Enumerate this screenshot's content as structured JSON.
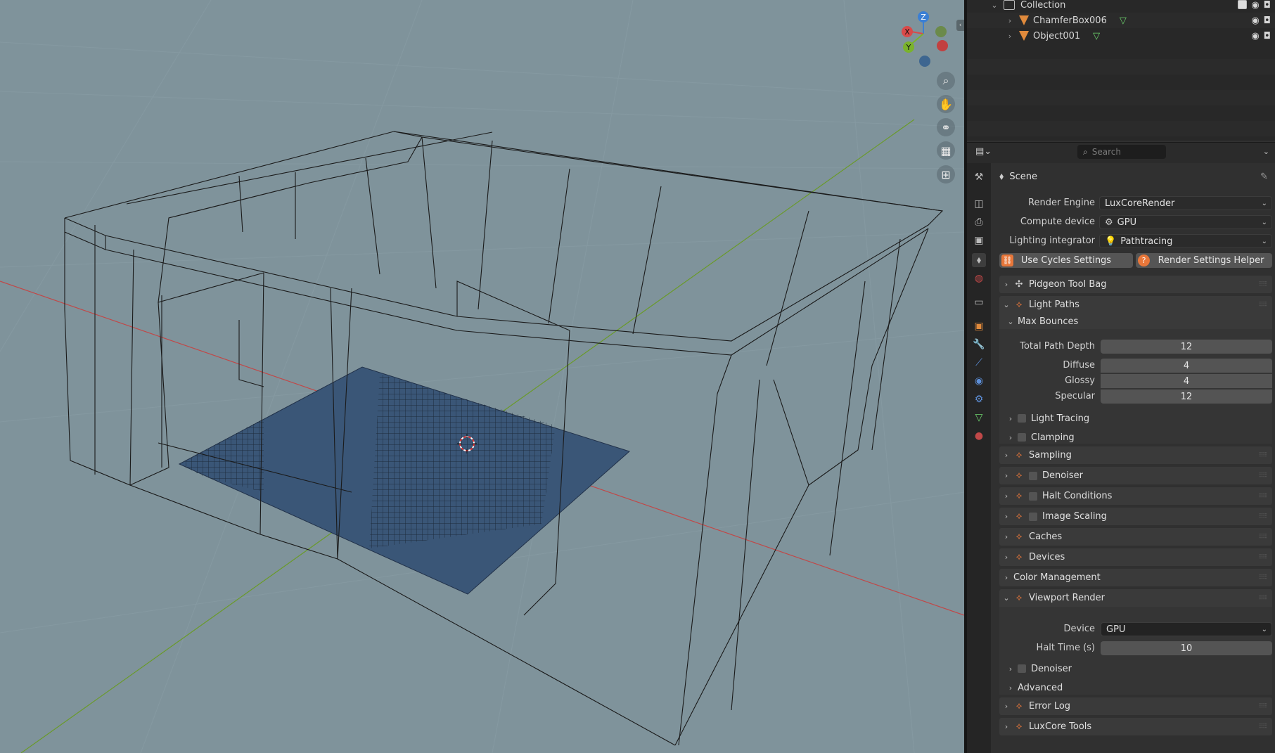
{
  "outliner": {
    "collection_label": "Collection",
    "objects": [
      {
        "name": "ChamferBox006"
      },
      {
        "name": "Object001"
      }
    ]
  },
  "properties": {
    "search_placeholder": "Search",
    "context_title": "Scene",
    "render_engine": {
      "label": "Render Engine",
      "value": "LuxCoreRender"
    },
    "compute_device": {
      "label": "Compute device",
      "value": "GPU"
    },
    "lighting_integrator": {
      "label": "Lighting integrator",
      "value": "Pathtracing"
    },
    "use_cycles_button": "Use Cycles Settings",
    "render_helper_button": "Render Settings Helper",
    "panels": {
      "pidgeon": "Pidgeon Tool Bag",
      "light_paths": "Light Paths",
      "max_bounces": "Max Bounces",
      "total_path_depth": {
        "label": "Total Path Depth",
        "value": "12"
      },
      "diffuse": {
        "label": "Diffuse",
        "value": "4"
      },
      "glossy": {
        "label": "Glossy",
        "value": "4"
      },
      "specular": {
        "label": "Specular",
        "value": "12"
      },
      "light_tracing": "Light Tracing",
      "clamping": "Clamping",
      "sampling": "Sampling",
      "denoiser": "Denoiser",
      "halt_conditions": "Halt Conditions",
      "image_scaling": "Image Scaling",
      "caches": "Caches",
      "devices": "Devices",
      "color_management": "Color Management",
      "viewport_render": "Viewport Render",
      "vp_device": {
        "label": "Device",
        "value": "GPU"
      },
      "vp_halt_time": {
        "label": "Halt Time (s)",
        "value": "10"
      },
      "vp_denoiser": "Denoiser",
      "vp_advanced": "Advanced",
      "error_log": "Error Log",
      "luxcore_tools": "LuxCore Tools"
    }
  },
  "gizmo": {
    "z": "Z",
    "x": "X",
    "y": "Y"
  },
  "colors": {
    "accent": "#e8773a",
    "viewport_bg": "#7f939b",
    "floor": "#3a5677",
    "axis_red": "#c04848",
    "axis_green": "#6a9a2a"
  }
}
